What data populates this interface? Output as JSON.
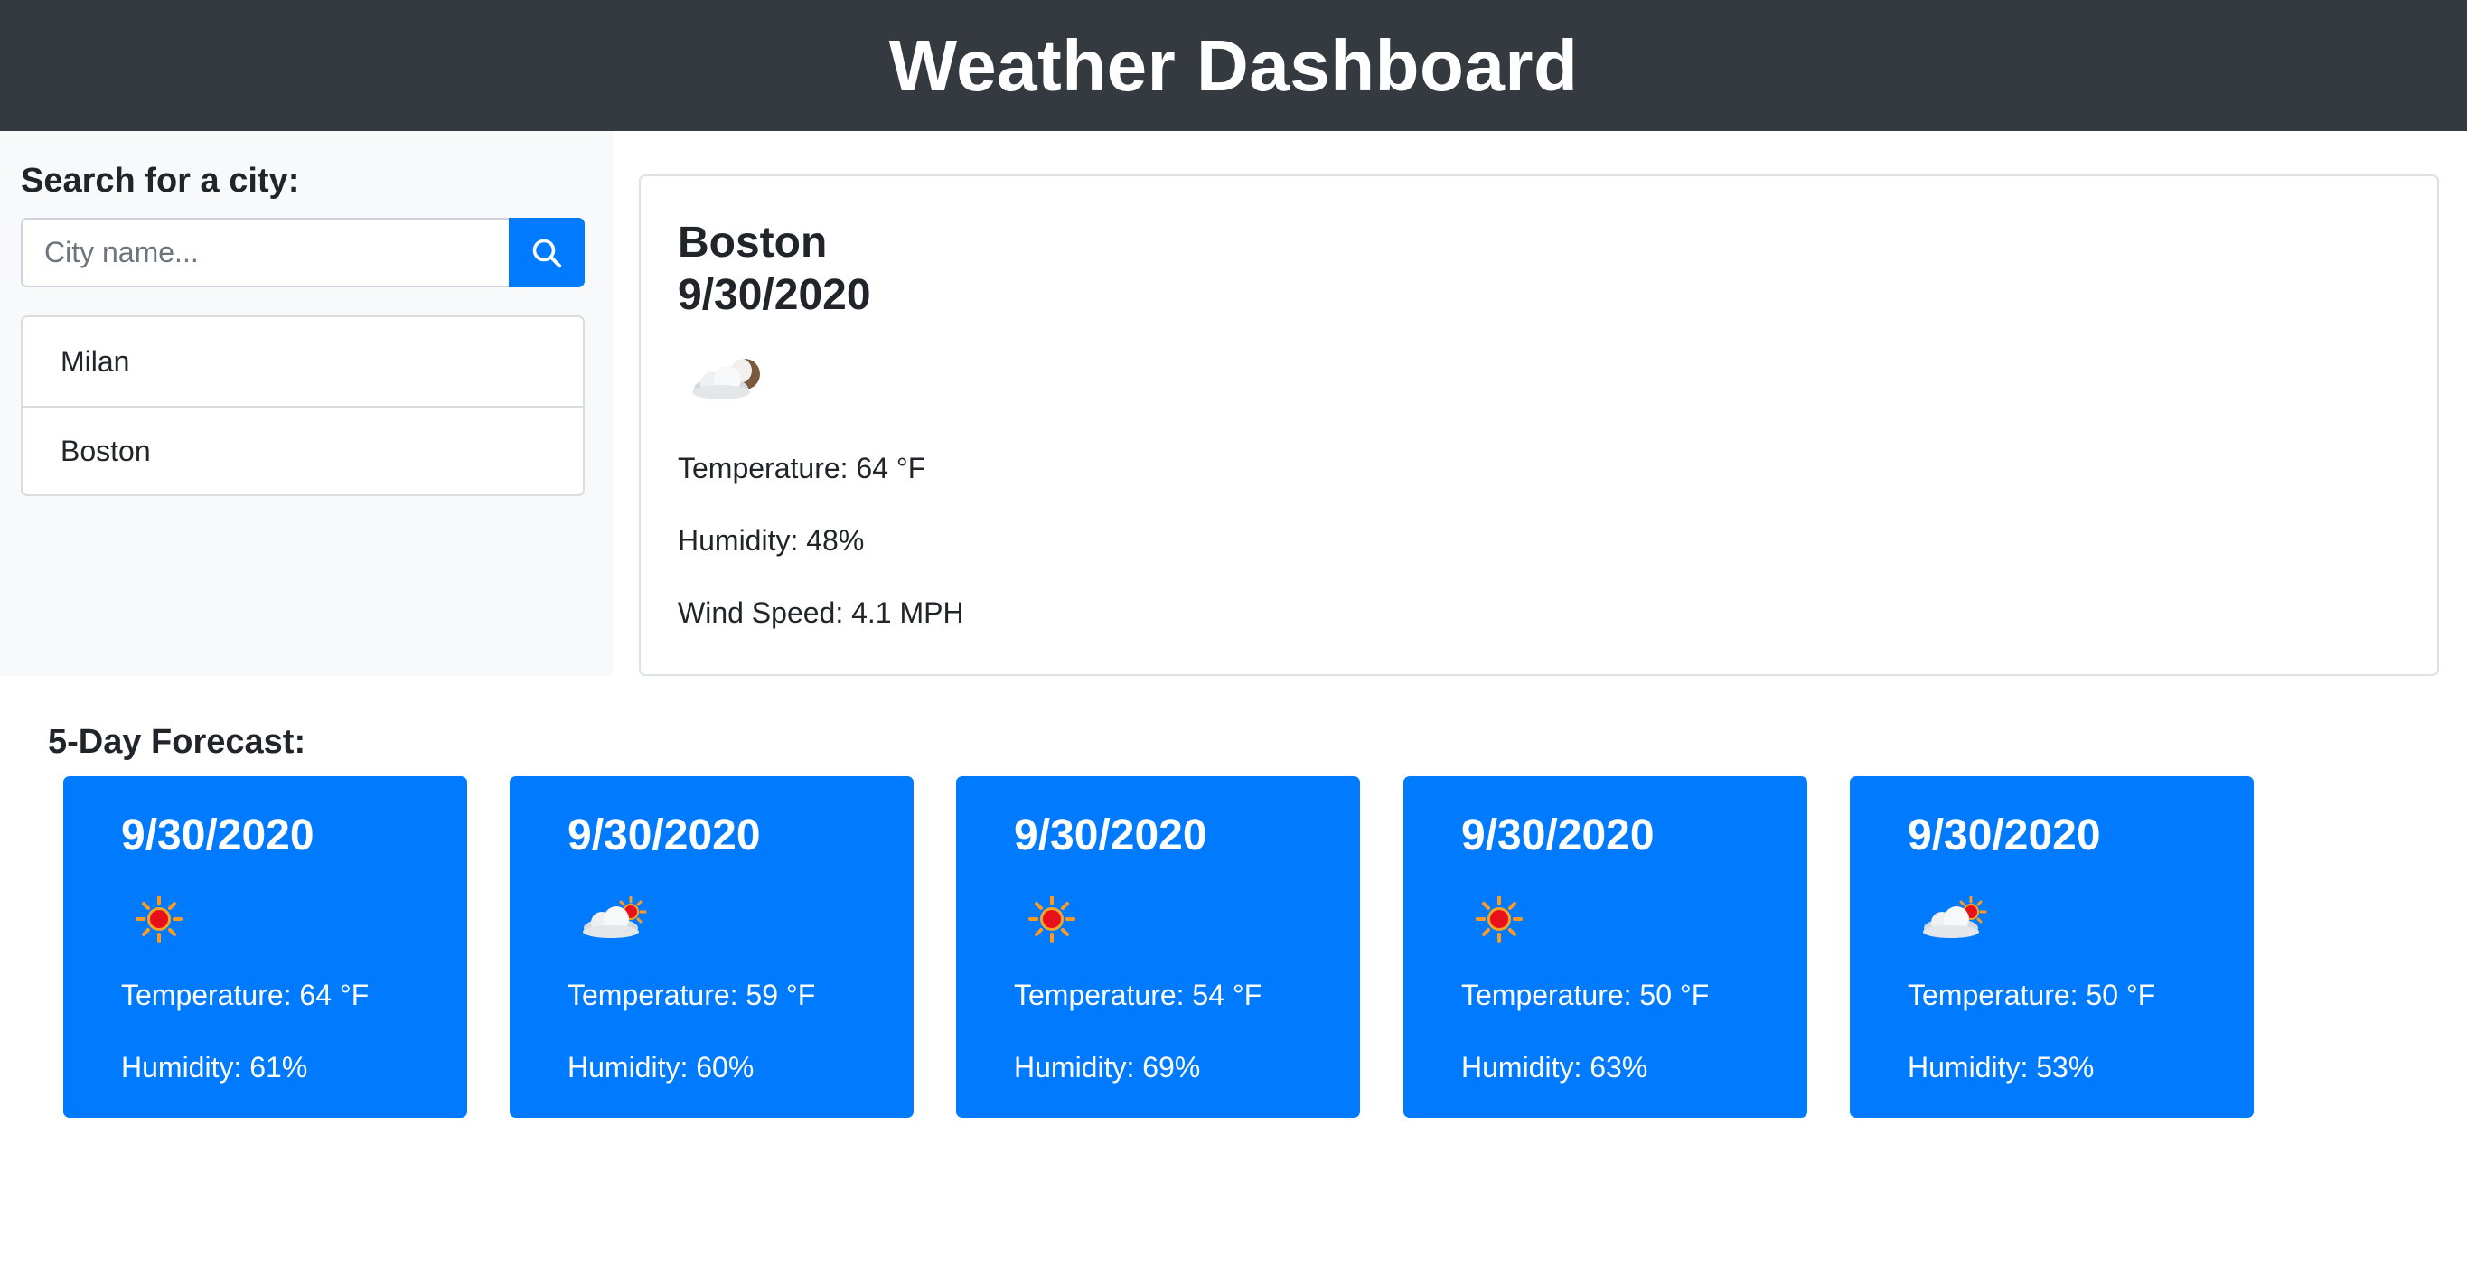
{
  "header": {
    "title": "Weather Dashboard"
  },
  "sidebar": {
    "search_label": "Search for a city:",
    "search_placeholder": "City name...",
    "history": [
      "Milan",
      "Boston"
    ]
  },
  "current": {
    "city": "Boston",
    "date": "9/30/2020",
    "icon": "cloud-moon-icon",
    "temperature": "Temperature: 64 °F",
    "humidity": "Humidity: 48%",
    "wind": "Wind Speed: 4.1 MPH"
  },
  "forecast": {
    "title": "5-Day Forecast:",
    "days": [
      {
        "date": "9/30/2020",
        "icon": "sun-icon",
        "temperature": "Temperature: 64 °F",
        "humidity": "Humidity: 61%"
      },
      {
        "date": "9/30/2020",
        "icon": "cloud-sun-icon",
        "temperature": "Temperature: 59 °F",
        "humidity": "Humidity: 60%"
      },
      {
        "date": "9/30/2020",
        "icon": "sun-icon",
        "temperature": "Temperature: 54 °F",
        "humidity": "Humidity: 69%"
      },
      {
        "date": "9/30/2020",
        "icon": "sun-icon",
        "temperature": "Temperature: 50 °F",
        "humidity": "Humidity: 63%"
      },
      {
        "date": "9/30/2020",
        "icon": "cloud-sun-icon",
        "temperature": "Temperature: 50 °F",
        "humidity": "Humidity: 53%"
      }
    ]
  },
  "colors": {
    "header_bg": "#343a40",
    "accent": "#007bff",
    "sidebar_bg": "#f8f9fa"
  }
}
